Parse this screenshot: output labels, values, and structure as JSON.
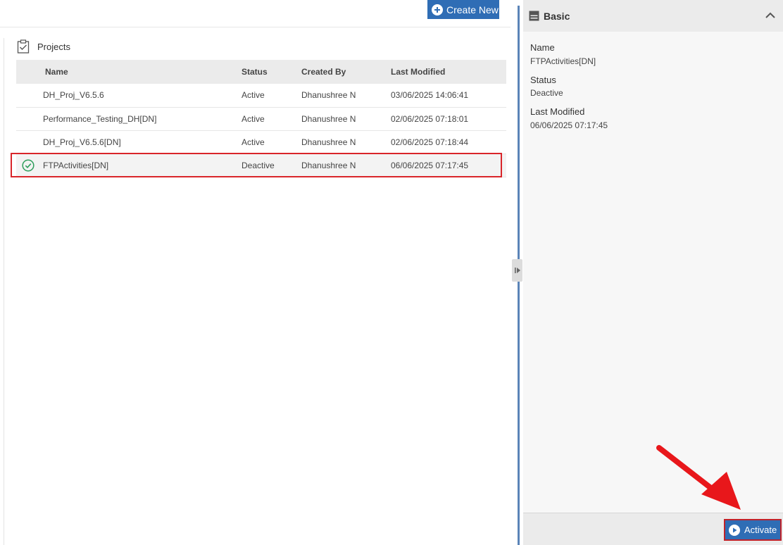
{
  "toolbar": {
    "create_new_label": "Create New"
  },
  "projects": {
    "title": "Projects",
    "columns": [
      "Name",
      "Status",
      "Created By",
      "Last Modified"
    ],
    "rows": [
      {
        "name": "DH_Proj_V6.5.6",
        "status": "Active",
        "created_by": "Dhanushree N",
        "last_modified": "03/06/2025 14:06:41",
        "selected": false
      },
      {
        "name": "Performance_Testing_DH[DN]",
        "status": "Active",
        "created_by": "Dhanushree N",
        "last_modified": "02/06/2025 07:18:01",
        "selected": false
      },
      {
        "name": "DH_Proj_V6.5.6[DN]",
        "status": "Active",
        "created_by": "Dhanushree N",
        "last_modified": "02/06/2025 07:18:44",
        "selected": false
      },
      {
        "name": "FTPActivities[DN]",
        "status": "Deactive",
        "created_by": "Dhanushree N",
        "last_modified": "06/06/2025 07:17:45",
        "selected": true
      }
    ]
  },
  "details": {
    "section_title": "Basic",
    "name_label": "Name",
    "name_value": "FTPActivities[DN]",
    "status_label": "Status",
    "status_value": "Deactive",
    "modified_label": "Last Modified",
    "modified_value": "06/06/2025 07:17:45"
  },
  "footer": {
    "activate_label": "Activate"
  },
  "colors": {
    "primary": "#2f6db5",
    "highlight": "#d9252a",
    "success": "#2e9e5b"
  },
  "icons": [
    "plus-circle-icon",
    "clipboard-icon",
    "check-circle-icon",
    "panel-icon",
    "chevron-up-icon",
    "play-circle-icon",
    "collapse-handle-icon"
  ]
}
